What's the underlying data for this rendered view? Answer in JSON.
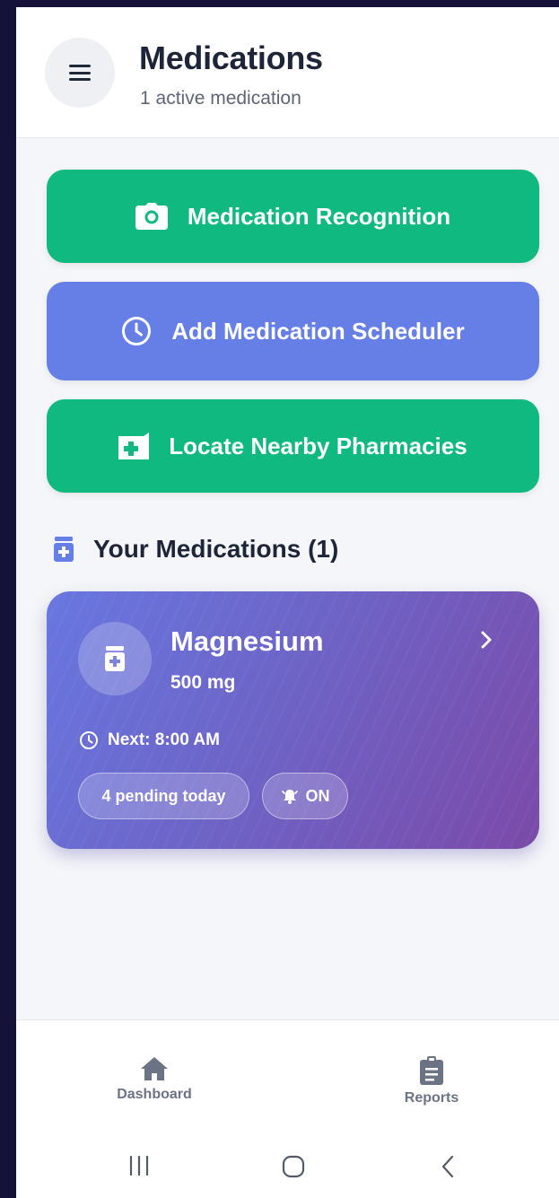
{
  "header": {
    "title": "Medications",
    "subtitle": "1 active medication",
    "menu_icon": "hamburger-menu-icon"
  },
  "actions": [
    {
      "label": "Medication Recognition",
      "icon": "camera-icon",
      "color": "#10b97f"
    },
    {
      "label": "Add Medication Scheduler",
      "icon": "clock-icon",
      "color": "#657fe6"
    },
    {
      "label": "Locate Nearby Pharmacies",
      "icon": "pharmacy-icon",
      "color": "#10b97f"
    }
  ],
  "section": {
    "title": "Your Medications (1)",
    "icon": "pill-bottle-icon"
  },
  "medications": [
    {
      "name": "Magnesium",
      "dose": "500 mg",
      "next": "Next: 8:00 AM",
      "pending": "4 pending today",
      "alarm": "ON"
    }
  ],
  "bottom_nav": {
    "items": [
      {
        "label": "Dashboard",
        "icon": "home-icon"
      },
      {
        "label": "Reports",
        "icon": "clipboard-icon"
      }
    ]
  },
  "colors": {
    "accent_green": "#10b97f",
    "accent_blue": "#657fe6",
    "card_gradient_start": "#6877e0",
    "card_gradient_end": "#7b4aa8"
  }
}
